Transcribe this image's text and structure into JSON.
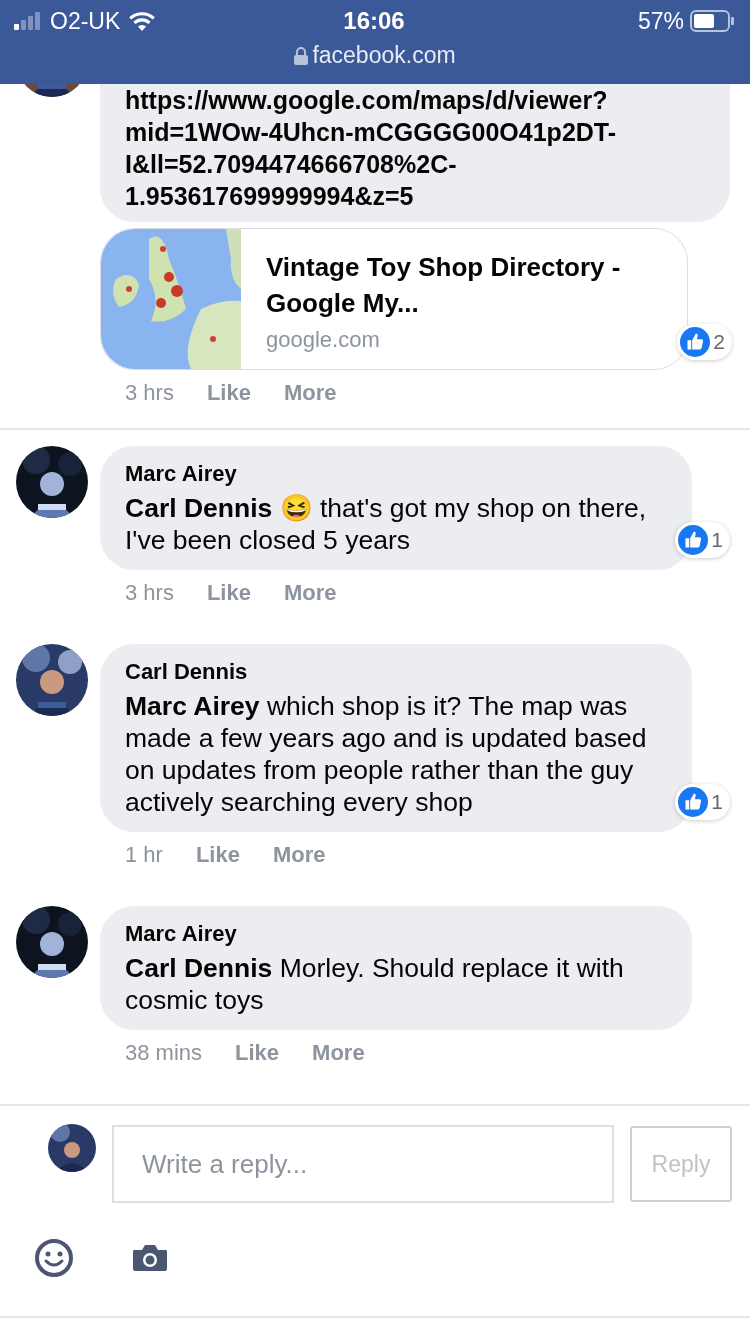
{
  "status_bar": {
    "carrier": "O2-UK",
    "time": "16:06",
    "battery": "57%",
    "url": "facebook.com"
  },
  "comments": [
    {
      "kind": "url",
      "lines": [
        "https://www.google.com/maps/d/viewer?",
        "mid=1WOw-4Uhcn-mCGGGG00O41p2DT-",
        "I&ll=52.7094474666708%2C-",
        "1.953617699999994&z=5"
      ],
      "preview": {
        "title": "Vintage Toy Shop Directory - Google My...",
        "domain": "google.com"
      },
      "reactions": "2",
      "time": "3 hrs",
      "actions": [
        "Like",
        "More"
      ]
    },
    {
      "kind": "reply",
      "author": "Marc Airey",
      "text": "**Carl Dennis** 😆 that's got my shop on there, I've been closed 5 years",
      "reactions": "1",
      "time": "3 hrs",
      "actions": [
        "Like",
        "More"
      ]
    },
    {
      "kind": "reply",
      "author": "Carl Dennis",
      "text": "**Marc Airey** which shop is it? The map was made a few years ago and is updated based on updates from people rather than the guy actively searching every shop",
      "reactions": "1",
      "time": "1 hr",
      "actions": [
        "Like",
        "More"
      ]
    },
    {
      "kind": "reply",
      "author": "Marc Airey",
      "text": "**Carl Dennis** Morley. Should replace it with cosmic toys",
      "time": "38 mins",
      "actions": [
        "Like",
        "More"
      ]
    }
  ],
  "composer": {
    "placeholder": "Write a reply...",
    "button": "Reply",
    "button_disabled": true
  }
}
